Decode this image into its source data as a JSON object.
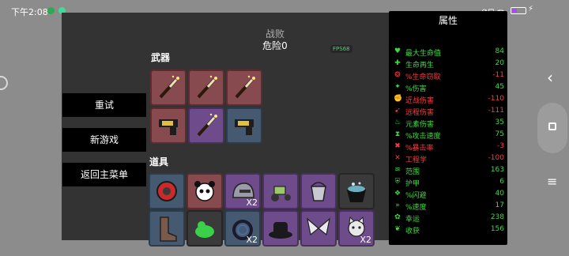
{
  "status_bar": {
    "time": "下午2:08",
    "right_icons": "⊘⊡ ᯤ",
    "battery_color": "#b044ff"
  },
  "game": {
    "title": "战败",
    "danger": "危险0",
    "fps": "FPS68"
  },
  "menu": {
    "retry": "重试",
    "new_game": "新游戏",
    "main_menu": "返回主菜单"
  },
  "weapons": {
    "label": "武器",
    "slots": [
      {
        "icon": "wand-icon",
        "tier": "red"
      },
      {
        "icon": "wand-icon",
        "tier": "red"
      },
      {
        "icon": "wand-icon",
        "tier": "red"
      },
      {
        "icon": "gun-icon",
        "tier": "red"
      },
      {
        "icon": "wand-icon",
        "tier": "purple"
      },
      {
        "icon": "gun-icon",
        "tier": "blue"
      }
    ]
  },
  "items": {
    "label": "道具",
    "slots": [
      {
        "icon": "ring-target-icon",
        "tier": "blue",
        "qty": ""
      },
      {
        "icon": "panda-icon",
        "tier": "red",
        "qty": ""
      },
      {
        "icon": "helmet-icon",
        "tier": "purple",
        "qty": "X2"
      },
      {
        "icon": "tractor-icon",
        "tier": "purple",
        "qty": ""
      },
      {
        "icon": "bucket-icon",
        "tier": "purple",
        "qty": ""
      },
      {
        "icon": "cauldron-icon",
        "tier": "dark",
        "qty": ""
      },
      {
        "icon": "boot-icon",
        "tier": "blue",
        "qty": ""
      },
      {
        "icon": "slime-icon",
        "tier": "dark",
        "qty": ""
      },
      {
        "icon": "coil-icon",
        "tier": "blue",
        "qty": "X2"
      },
      {
        "icon": "hat-icon",
        "tier": "purple",
        "qty": ""
      },
      {
        "icon": "wings-icon",
        "tier": "purple",
        "qty": ""
      },
      {
        "icon": "cat-icon",
        "tier": "purple",
        "qty": "X2"
      }
    ]
  },
  "stats": {
    "title": "属性",
    "rows": [
      {
        "icon": "♥",
        "icon_name": "heart-icon",
        "name": "最大生命值",
        "value": "84",
        "color": "green"
      },
      {
        "icon": "✚",
        "icon_name": "regen-icon",
        "name": "生命再生",
        "value": "20",
        "color": "green"
      },
      {
        "icon": "❂",
        "icon_name": "lifesteal-icon",
        "name": "%生命窃取",
        "value": "-11",
        "color": "red"
      },
      {
        "icon": "✦",
        "icon_name": "damage-icon",
        "name": "%伤害",
        "value": "45",
        "color": "green"
      },
      {
        "icon": "✊",
        "icon_name": "melee-icon",
        "name": "近战伤害",
        "value": "-110",
        "color": "red"
      },
      {
        "icon": "➹",
        "icon_name": "ranged-icon",
        "name": "远程伤害",
        "value": "-111",
        "color": "red"
      },
      {
        "icon": "♨",
        "icon_name": "elemental-icon",
        "name": "元素伤害",
        "value": "35",
        "color": "green"
      },
      {
        "icon": "⧗",
        "icon_name": "attack-speed-icon",
        "name": "%攻击速度",
        "value": "75",
        "color": "green"
      },
      {
        "icon": "✖",
        "icon_name": "crit-icon",
        "name": "%暴击率",
        "value": "-3",
        "color": "red"
      },
      {
        "icon": "✕",
        "icon_name": "engineering-icon",
        "name": "工程学",
        "value": "-100",
        "color": "red"
      },
      {
        "icon": "≋",
        "icon_name": "range-icon",
        "name": "范围",
        "value": "163",
        "color": "green"
      },
      {
        "icon": "⛨",
        "icon_name": "armor-icon",
        "name": "护甲",
        "value": "6",
        "color": "green"
      },
      {
        "icon": "❖",
        "icon_name": "dodge-icon",
        "name": "%闪避",
        "value": "40",
        "color": "green"
      },
      {
        "icon": "»",
        "icon_name": "speed-icon",
        "name": "%速度",
        "value": "17",
        "color": "green"
      },
      {
        "icon": "✿",
        "icon_name": "luck-icon",
        "name": "幸运",
        "value": "238",
        "color": "green"
      },
      {
        "icon": "❦",
        "icon_name": "harvest-icon",
        "name": "收获",
        "value": "156",
        "color": "green"
      }
    ]
  }
}
